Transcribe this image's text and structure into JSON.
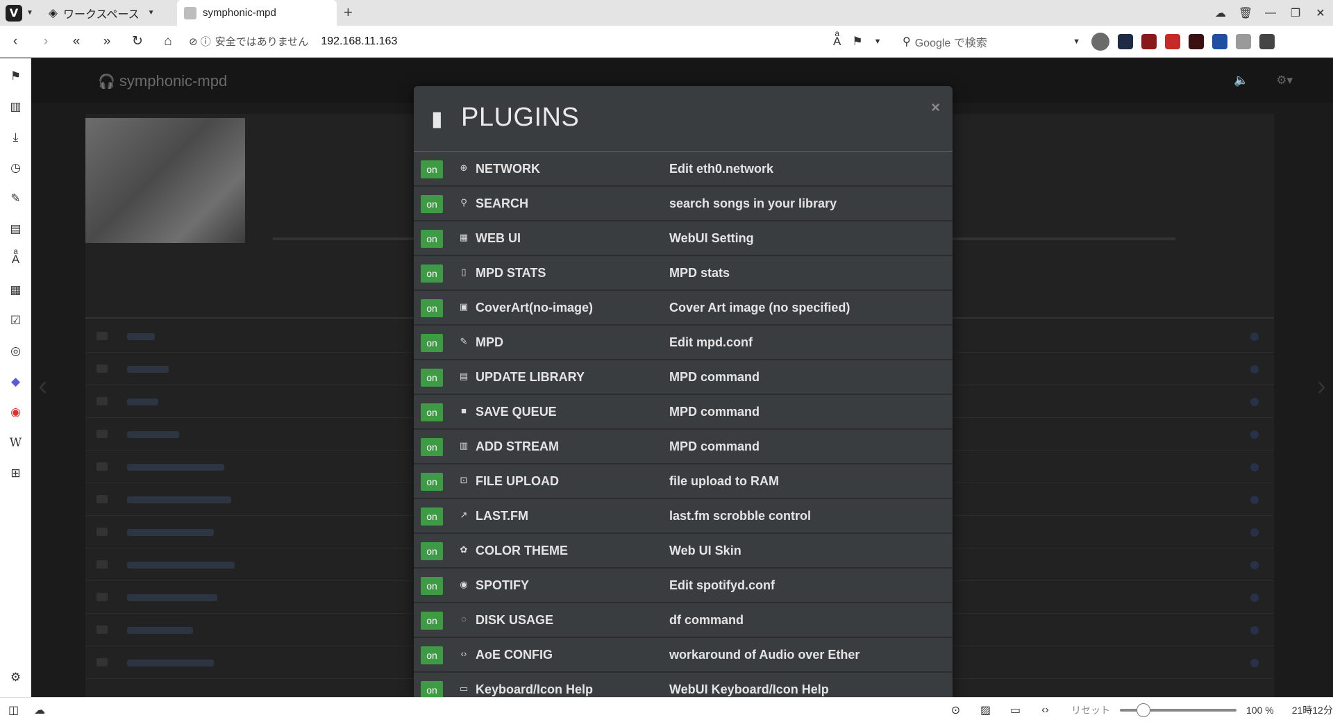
{
  "browser": {
    "workspace_label": "ワークスペース",
    "tab_title": "symphonic-mpd",
    "security_label": "安全ではありません",
    "url": "192.168.11.163",
    "search_placeholder": "Google で検索"
  },
  "statusbar": {
    "reset_label": "リセット",
    "zoom": "100 %",
    "clock": "21時12分"
  },
  "app": {
    "title": "symphonic-mpd"
  },
  "modal": {
    "title": "PLUGINS",
    "close": "×",
    "plugins": [
      {
        "status": "on",
        "icon": "globe-icon",
        "glyph": "⊕",
        "name": "NETWORK",
        "desc": "Edit eth0.network"
      },
      {
        "status": "on",
        "icon": "search-icon",
        "glyph": "⚲",
        "name": "SEARCH",
        "desc": "search songs in your library"
      },
      {
        "status": "on",
        "icon": "grid-icon",
        "glyph": "▦",
        "name": "WEB UI",
        "desc": "WebUI Setting"
      },
      {
        "status": "on",
        "icon": "phone-icon",
        "glyph": "▯",
        "name": "MPD STATS",
        "desc": "MPD stats"
      },
      {
        "status": "on",
        "icon": "image-icon",
        "glyph": "▣",
        "name": "CoverArt(no-image)",
        "desc": "Cover Art image (no specified)"
      },
      {
        "status": "on",
        "icon": "edit-icon",
        "glyph": "✎",
        "name": "MPD",
        "desc": "Edit mpd.conf"
      },
      {
        "status": "on",
        "icon": "file-icon",
        "glyph": "▤",
        "name": "UPDATE LIBRARY",
        "desc": "MPD command"
      },
      {
        "status": "on",
        "icon": "save-icon",
        "glyph": "■",
        "name": "SAVE QUEUE",
        "desc": "MPD command"
      },
      {
        "status": "on",
        "icon": "radio-icon",
        "glyph": "▥",
        "name": "ADD STREAM",
        "desc": "MPD command"
      },
      {
        "status": "on",
        "icon": "upload-icon",
        "glyph": "⊡",
        "name": "FILE UPLOAD",
        "desc": "file upload to RAM"
      },
      {
        "status": "on",
        "icon": "trend-icon",
        "glyph": "↗",
        "name": "LAST.FM",
        "desc": "last.fm scrobble control"
      },
      {
        "status": "on",
        "icon": "palette-icon",
        "glyph": "✿",
        "name": "COLOR THEME",
        "desc": "Web UI Skin"
      },
      {
        "status": "on",
        "icon": "spotify-icon",
        "glyph": "◉",
        "name": "SPOTIFY",
        "desc": "Edit spotifyd.conf"
      },
      {
        "status": "on",
        "icon": "disk-icon",
        "glyph": "◌",
        "name": "DISK USAGE",
        "desc": "df command"
      },
      {
        "status": "on",
        "icon": "code-icon",
        "glyph": "‹›",
        "name": "AoE CONFIG",
        "desc": "workaround of Audio over Ether"
      },
      {
        "status": "on",
        "icon": "keyboard-icon",
        "glyph": "▭",
        "name": "Keyboard/Icon Help",
        "desc": "WebUI Keyboard/Icon Help"
      }
    ]
  },
  "colors": {
    "toggle_on": "#3f9a45",
    "modal_bg": "#3a3d40",
    "backdrop": "#1b1b1b"
  }
}
